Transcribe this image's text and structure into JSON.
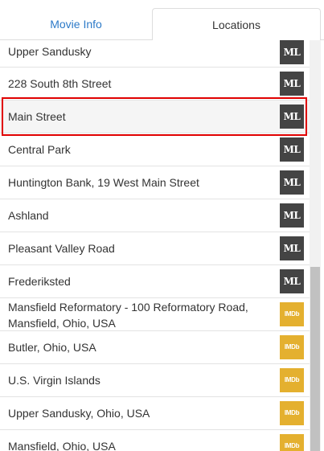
{
  "tabs": {
    "movie_info": "Movie Info",
    "locations": "Locations"
  },
  "locations": [
    {
      "name": "Upper Sandusky",
      "source": "ML"
    },
    {
      "name": "228 South 8th Street",
      "source": "ML"
    },
    {
      "name": "Main Street",
      "source": "ML",
      "selected": true
    },
    {
      "name": "Central Park",
      "source": "ML"
    },
    {
      "name": "Huntington Bank, 19 West Main Street",
      "source": "ML"
    },
    {
      "name": "Ashland",
      "source": "ML"
    },
    {
      "name": "Pleasant Valley Road",
      "source": "ML"
    },
    {
      "name": "Frederiksted",
      "source": "ML"
    },
    {
      "name": "Mansfield Reformatory - 100 Reformatory Road, Mansfield, Ohio, USA",
      "source": "IMDb"
    },
    {
      "name": "Butler, Ohio, USA",
      "source": "IMDb"
    },
    {
      "name": "U.S. Virgin Islands",
      "source": "IMDb"
    },
    {
      "name": "Upper Sandusky, Ohio, USA",
      "source": "IMDb"
    },
    {
      "name": "Mansfield, Ohio, USA",
      "source": "IMDb"
    }
  ],
  "colors": {
    "active_tab_text": "#333333",
    "inactive_tab_text": "#2d7ac8",
    "ml_badge": "#444444",
    "imdb_badge": "#e4b02f",
    "highlight_border": "#e00000"
  },
  "icons": {
    "ml": "ml-logo-icon",
    "imdb": "imdb-logo-icon"
  }
}
